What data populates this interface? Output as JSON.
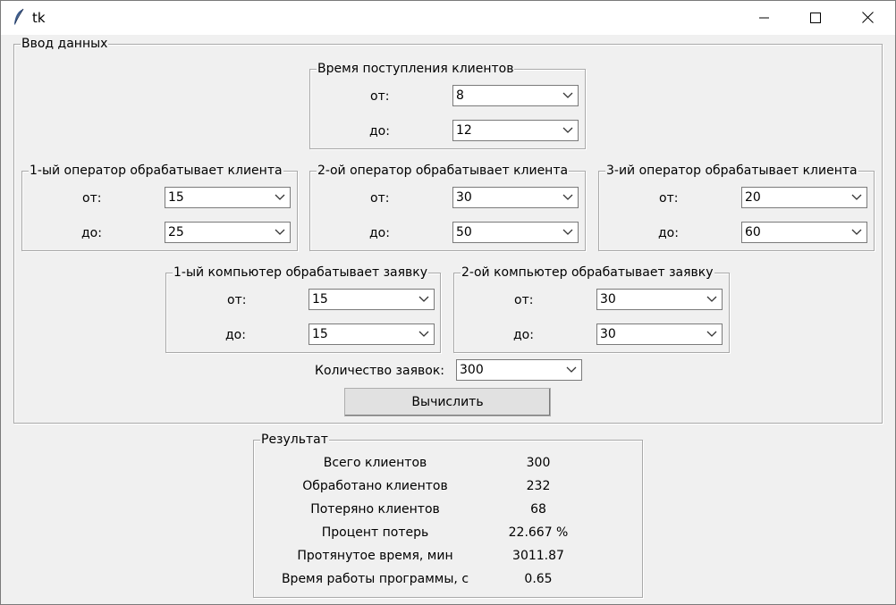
{
  "window": {
    "title": "tk",
    "icon": "feather-icon",
    "controls": [
      "minimize-icon",
      "maximize-icon",
      "close-icon"
    ]
  },
  "input_group": {
    "title": "Ввод данных",
    "arrival": {
      "title": "Время поступления клиентов",
      "from_label": "от:",
      "from_value": "8",
      "to_label": "до:",
      "to_value": "12"
    },
    "operator1": {
      "title": "1-ый оператор обрабатывает клиента",
      "from_label": "от:",
      "from_value": "15",
      "to_label": "до:",
      "to_value": "25"
    },
    "operator2": {
      "title": "2-ой оператор обрабатывает клиента",
      "from_label": "от:",
      "from_value": "30",
      "to_label": "до:",
      "to_value": "50"
    },
    "operator3": {
      "title": "3-ий оператор обрабатывает клиента",
      "from_label": "от:",
      "from_value": "20",
      "to_label": "до:",
      "to_value": "60"
    },
    "computer1": {
      "title": "1-ый компьютер обрабатывает заявку",
      "from_label": "от:",
      "from_value": "15",
      "to_label": "до:",
      "to_value": "15"
    },
    "computer2": {
      "title": "2-ой компьютер обрабатывает заявку",
      "from_label": "от:",
      "from_value": "30",
      "to_label": "до:",
      "to_value": "30"
    },
    "requests_label": "Количество заявок:",
    "requests_value": "300",
    "calc_button": "Вычислить"
  },
  "result_group": {
    "title": "Результат",
    "rows": [
      {
        "label": "Всего клиентов",
        "value": "300"
      },
      {
        "label": "Обработано клиентов",
        "value": "232"
      },
      {
        "label": "Потеряно клиентов",
        "value": "68"
      },
      {
        "label": "Процент потерь",
        "value": "22.667 %"
      },
      {
        "label": "Протянутое время, мин",
        "value": "3011.87"
      },
      {
        "label": "Время работы программы, с",
        "value": "0.65"
      }
    ]
  }
}
